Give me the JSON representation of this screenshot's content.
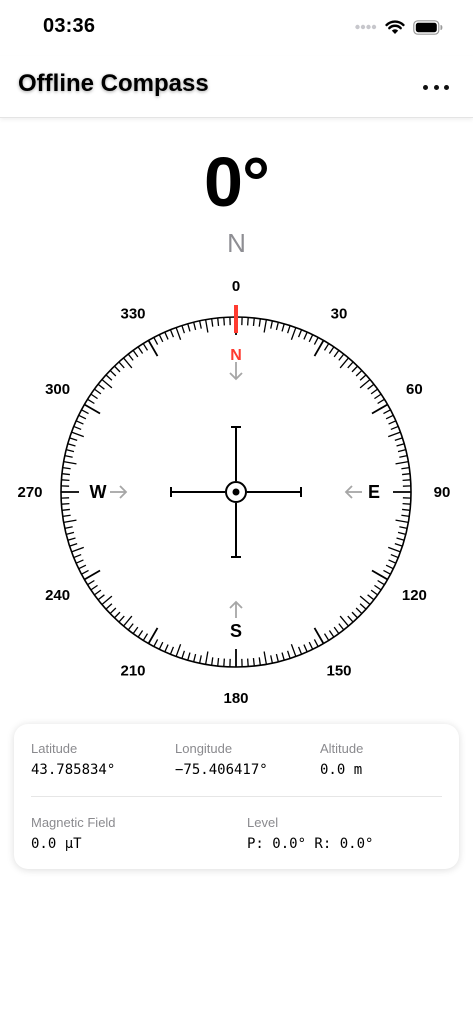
{
  "status_bar": {
    "time": "03:36"
  },
  "nav": {
    "title": "Offline Compass"
  },
  "heading": {
    "degrees": "0°",
    "direction": "N"
  },
  "compass": {
    "heading_deg": 0,
    "accent_color": "#ff3b30",
    "dial_labels": [
      {
        "deg": 0,
        "text": "0"
      },
      {
        "deg": 30,
        "text": "30"
      },
      {
        "deg": 60,
        "text": "60"
      },
      {
        "deg": 90,
        "text": "90"
      },
      {
        "deg": 120,
        "text": "120"
      },
      {
        "deg": 150,
        "text": "150"
      },
      {
        "deg": 180,
        "text": "180"
      },
      {
        "deg": 210,
        "text": "210"
      },
      {
        "deg": 240,
        "text": "240"
      },
      {
        "deg": 270,
        "text": "270"
      },
      {
        "deg": 300,
        "text": "300"
      },
      {
        "deg": 330,
        "text": "330"
      }
    ],
    "cardinals": {
      "north": "N",
      "east": "E",
      "south": "S",
      "west": "W"
    }
  },
  "info": {
    "latitude_label": "Latitude",
    "latitude_value": "43.785834°",
    "longitude_label": "Longitude",
    "longitude_value": "−75.406417°",
    "altitude_label": "Altitude",
    "altitude_value": "0.0 m",
    "magnetic_label": "Magnetic Field",
    "magnetic_value": "0.0 µT",
    "level_label": "Level",
    "level_value": "P: 0.0° R: 0.0°"
  }
}
